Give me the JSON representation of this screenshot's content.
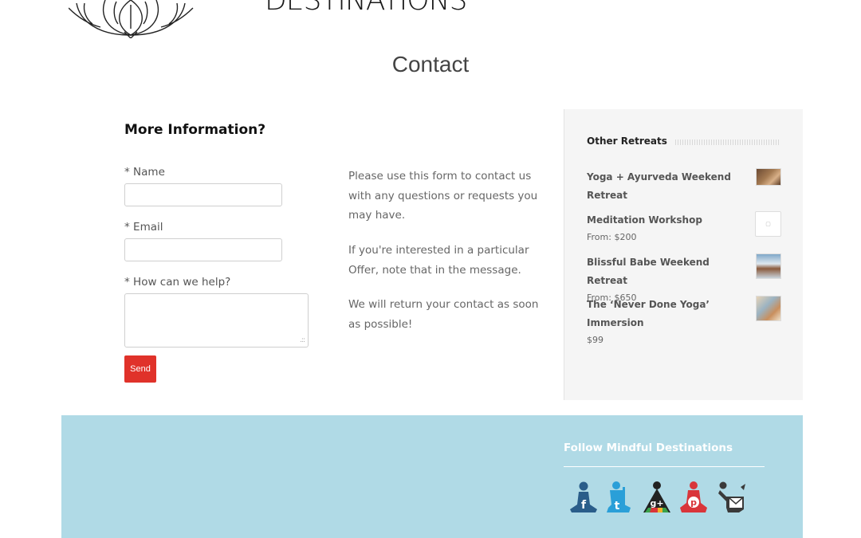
{
  "header": {
    "logo_text": "DESTINATIONS",
    "page_title": "Contact"
  },
  "form": {
    "heading": "More Information?",
    "name_label": "* Name",
    "email_label": "* Email",
    "help_label": "* How can we help?",
    "send_label": "Send"
  },
  "info": {
    "paragraphs": [
      "Please use this form to contact us with any questions or requests you may have.",
      "If you're interested in a particular Offer, note that in the message.",
      "We will return your contact as soon as possible!"
    ]
  },
  "sidebar": {
    "title": "Other Retreats",
    "retreats": [
      {
        "name": "Yoga + Ayurveda Weekend Retreat",
        "price": ""
      },
      {
        "name": "Meditation Workshop",
        "price": "From: $200"
      },
      {
        "name": "Blissful Babe Weekend Retreat",
        "price": "From: $650"
      },
      {
        "name": "The ‘Never Done Yoga’ Immersion",
        "price": "$99"
      }
    ]
  },
  "footer": {
    "follow_title": "Follow Mindful Destinations",
    "social_icons": [
      "facebook-icon",
      "twitter-icon",
      "google-plus-icon",
      "pinterest-icon",
      "email-icon"
    ]
  },
  "colors": {
    "accent_red": "#e0322a",
    "footer_bg": "#b0dae6",
    "social_blue": "#2a5d8a",
    "social_red": "#d9353a"
  }
}
